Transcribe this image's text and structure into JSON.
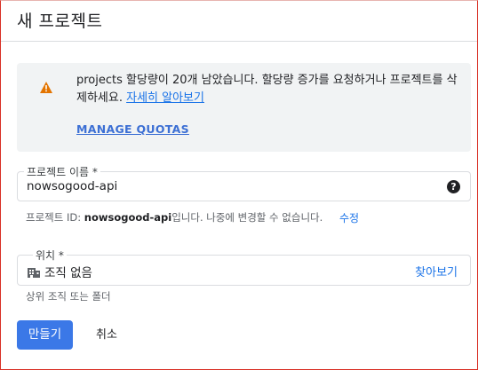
{
  "header": {
    "title": "새 프로젝트"
  },
  "alert": {
    "message_text": "projects 할당량이 20개 남았습니다. 할당량 증가를 요청하거나 프로젝트를 삭제하세요.",
    "learn_more_label": "자세히 알아보기",
    "manage_quotas_label": "MANAGE QUOTAS",
    "icon": "warning-icon",
    "icon_color": "#e37400"
  },
  "project_name": {
    "label": "프로젝트 이름 *",
    "value": "nowsogood-api",
    "help_icon": "question-circle-icon",
    "help_glyph": "?"
  },
  "project_id": {
    "prefix": "프로젝트 ID: ",
    "id_value": "nowsogood-api",
    "suffix": "입니다. 나중에 변경할 수 없습니다.",
    "edit_label": "수정"
  },
  "location": {
    "label": "위치 *",
    "value": "조직 없음",
    "browse_label": "찾아보기",
    "hint": "상위 조직 또는 폴더",
    "icon": "organization-icon"
  },
  "actions": {
    "create_label": "만들기",
    "cancel_label": "취소",
    "primary_color": "#3b78e7"
  }
}
